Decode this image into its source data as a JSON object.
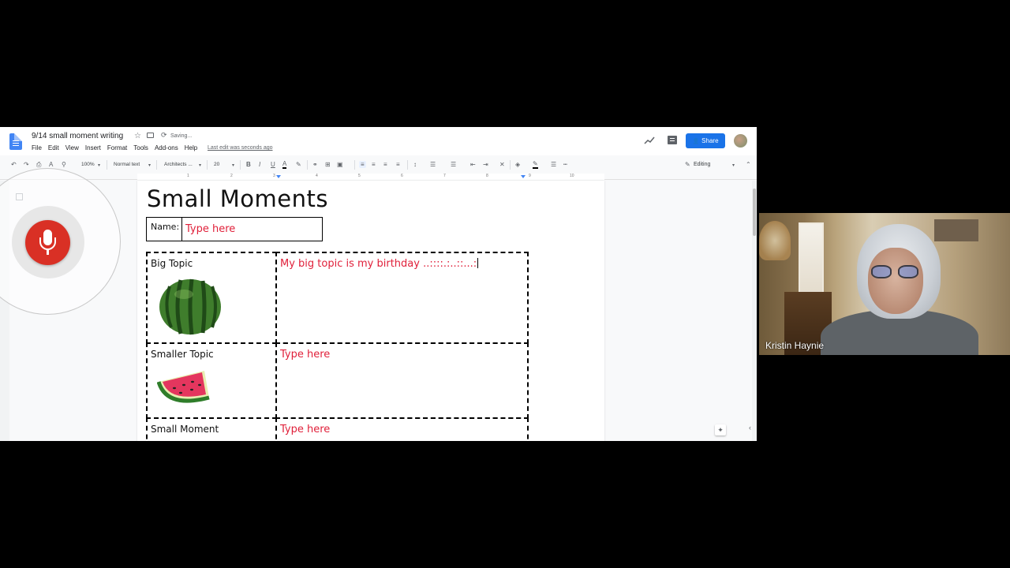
{
  "docs": {
    "title": "9/14 small moment writing",
    "save_status": "Saving...",
    "last_edit": "Last edit was seconds ago",
    "menu": [
      "File",
      "Edit",
      "View",
      "Insert",
      "Format",
      "Tools",
      "Add-ons",
      "Help"
    ],
    "share_label": "Share",
    "toolbar": {
      "zoom": "100%",
      "style": "Normal text",
      "font": "Architects ...",
      "font_size": "20",
      "editing_mode": "Editing"
    },
    "ruler_numbers": [
      "1",
      "2",
      "3",
      "4",
      "5",
      "6",
      "7",
      "8",
      "9",
      "10"
    ],
    "accent_color": "#1a73e8",
    "mic_color": "#d93025"
  },
  "document": {
    "heading": "Small Moments",
    "name_label": "Name:",
    "name_value": "Type here",
    "rows": [
      {
        "label": "Big Topic",
        "value": "My big topic is my birthday ..::::.:..::...:"
      },
      {
        "label": "Smaller Topic",
        "value": "Type here"
      },
      {
        "label": "Small Moment",
        "value": "Type here"
      }
    ],
    "answer_color": "#e0203a"
  },
  "webcam": {
    "participant_name": "Kristin Haynie"
  }
}
